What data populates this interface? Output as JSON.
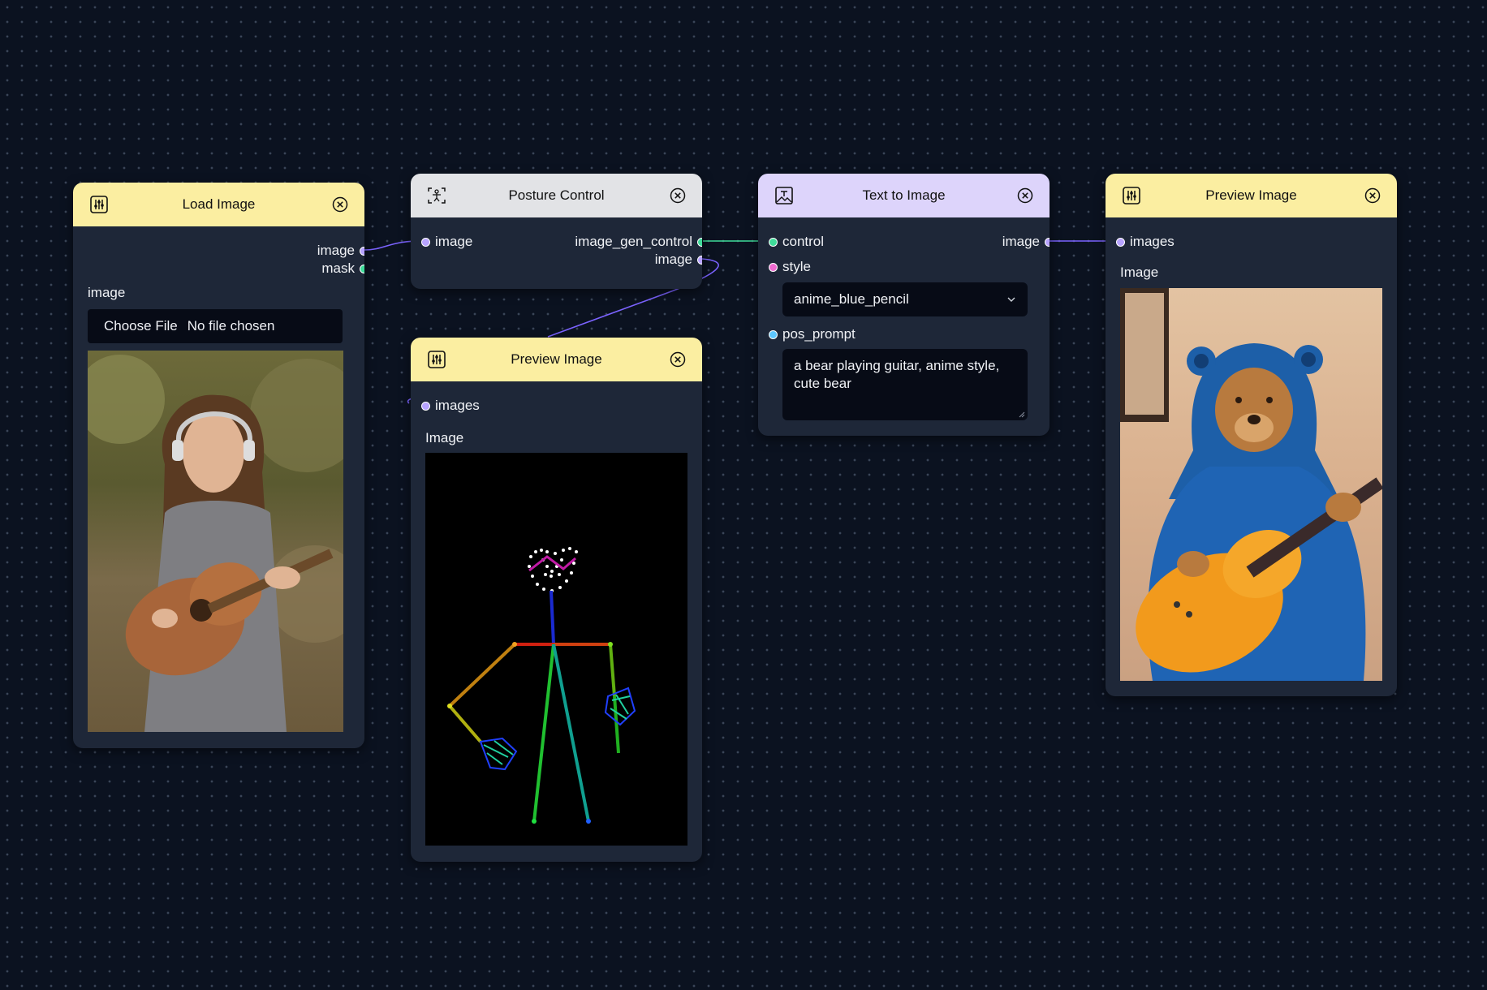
{
  "nodes": {
    "load_image": {
      "title": "Load Image",
      "outputs": [
        "image",
        "mask"
      ],
      "section_label": "image",
      "choose_button": "Choose File",
      "file_status": "No file chosen"
    },
    "posture_control": {
      "title": "Posture Control",
      "input": "image",
      "outputs": [
        "image_gen_control",
        "image"
      ]
    },
    "preview_pose": {
      "title": "Preview Image",
      "input": "images",
      "section_label": "Image"
    },
    "text_to_image": {
      "title": "Text to Image",
      "inputs": [
        "control",
        "style",
        "pos_prompt"
      ],
      "output": "image",
      "style_value": "anime_blue_pencil",
      "prompt_value": "a bear playing guitar, anime style, cute bear"
    },
    "preview_result": {
      "title": "Preview Image",
      "input": "images",
      "section_label": "Image"
    }
  },
  "colors": {
    "canvas": "#0b1220",
    "node_body": "#1e2738",
    "header_yellow": "#fbeea1",
    "header_grey": "#e2e3e6",
    "header_purple": "#ddd4fb",
    "port_image": "#b7a3ff",
    "port_control": "#3fdc9a",
    "port_style": "#f06ad0",
    "port_prompt": "#5ec8ff"
  },
  "icons": {
    "load_image": "sliders-icon",
    "posture_control": "pose-scan-icon",
    "text_to_image": "image-text-icon",
    "preview": "sliders-icon",
    "close": "close-circle-icon",
    "select": "chevron-down-icon"
  }
}
